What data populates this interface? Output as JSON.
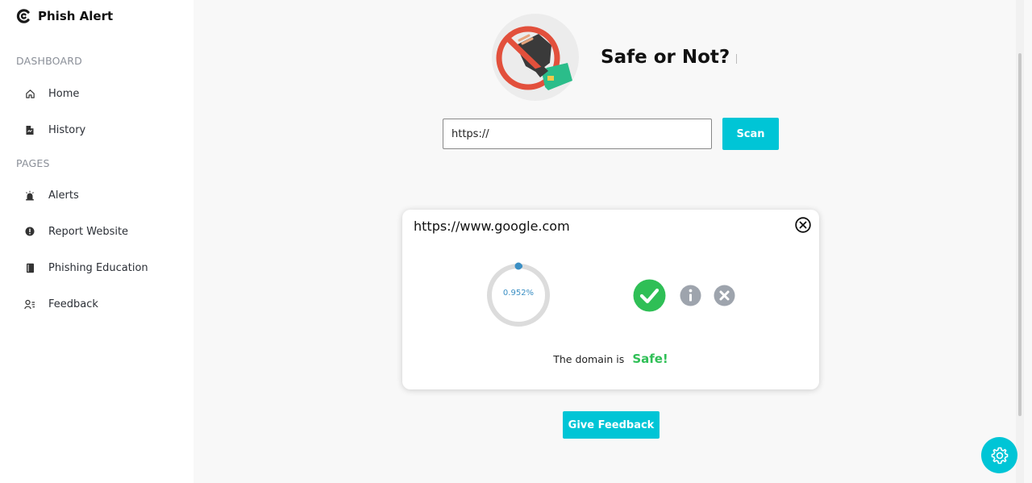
{
  "app": {
    "name": "Phish Alert"
  },
  "sidebar": {
    "sections": [
      {
        "label": "DASHBOARD",
        "items": [
          {
            "label": "Home",
            "icon": "home-icon"
          },
          {
            "label": "History",
            "icon": "document-icon"
          }
        ]
      },
      {
        "label": "PAGES",
        "items": [
          {
            "label": "Alerts",
            "icon": "alarm-icon"
          },
          {
            "label": "Report Website",
            "icon": "exclamation-circle-icon"
          },
          {
            "label": "Phishing Education",
            "icon": "book-icon"
          },
          {
            "label": "Feedback",
            "icon": "user-list-icon"
          }
        ]
      }
    ]
  },
  "hero": {
    "title": "Safe or Not?",
    "image": "no-phishing-hand-card-icon"
  },
  "search": {
    "value": "https://",
    "button_label": "Scan"
  },
  "result": {
    "url": "https://www.google.com",
    "score_label": "0.952%",
    "score_fraction": 0.00952,
    "verdict_prefix": "The domain is",
    "verdict": "Safe!",
    "status_icons": [
      "check-circle-icon",
      "info-circle-icon",
      "x-circle-icon"
    ]
  },
  "feedback_button": {
    "label": "Give Feedback"
  },
  "colors": {
    "accent": "#00c5d6",
    "safe": "#2fbf56",
    "neutral_icon": "#9ea4ad",
    "gauge_track": "#dcdcdc",
    "gauge_fill": "#3b8fc4"
  }
}
